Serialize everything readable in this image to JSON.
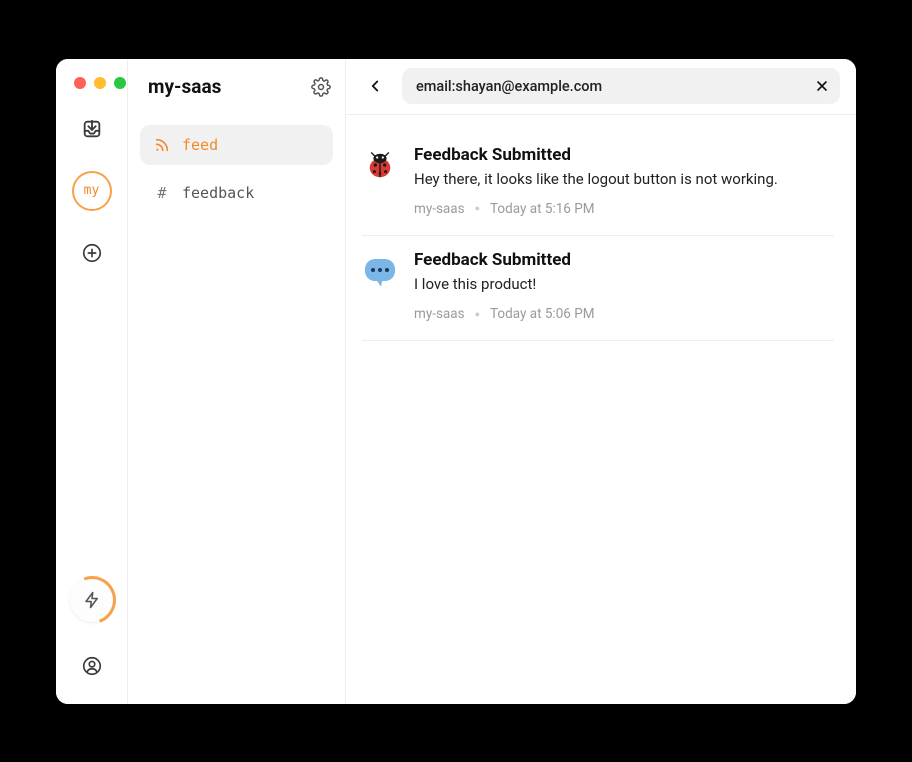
{
  "workspace": {
    "title": "my-saas",
    "avatar_label": "my"
  },
  "sidebar": {
    "items": [
      {
        "label": "feed",
        "icon": "rss-icon",
        "active": true
      },
      {
        "label": "feedback",
        "icon": "hash-icon",
        "active": false
      }
    ]
  },
  "toolbar": {
    "search_value": "email:shayan@example.com"
  },
  "feed": [
    {
      "icon": "ladybug",
      "title": "Feedback Submitted",
      "text": "Hey there, it looks like the logout button is not working.",
      "source": "my-saas",
      "time": "Today at 5:16 PM"
    },
    {
      "icon": "bubble",
      "title": "Feedback Submitted",
      "text": "I love this product!",
      "source": "my-saas",
      "time": "Today at 5:06 PM"
    }
  ]
}
